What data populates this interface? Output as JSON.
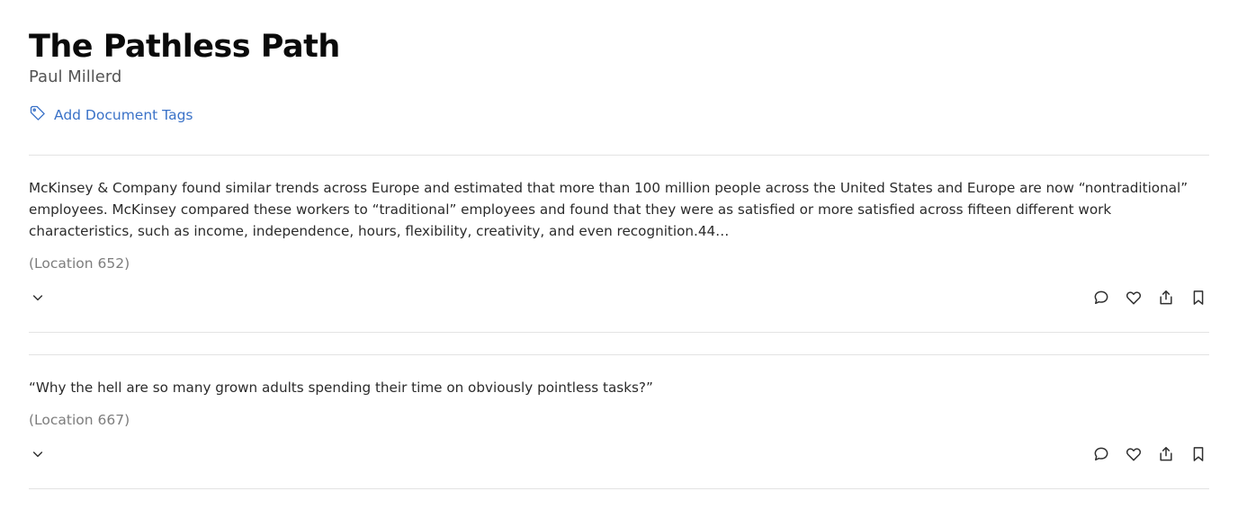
{
  "book": {
    "title": "The Pathless Path",
    "author": "Paul Millerd"
  },
  "tags": {
    "add_label": "Add Document Tags",
    "icon": "tag-icon"
  },
  "highlights": [
    {
      "text": "McKinsey & Company found similar trends across Europe and estimated that more than 100 million people across the United States and Europe are now “nontraditional” employees. McKinsey compared these workers to “traditional” employees and found that they were as satisfied or more satisfied across fifteen different work characteristics, such as income, independence, hours, flexibility, creativity, and even recognition.44…",
      "location": "(Location 652)"
    },
    {
      "text": "“Why the hell are so many grown adults spending their time on obviously pointless tasks?”",
      "location": "(Location 667)"
    }
  ],
  "icons": {
    "expand": "chevron-down-icon",
    "comment": "comment-icon",
    "favorite": "heart-icon",
    "share": "share-icon",
    "bookmark": "bookmark-icon"
  },
  "colors": {
    "link": "#3a72c8",
    "text": "#2b2b2b",
    "muted": "#7d7d7d",
    "divider": "#e3e3e3"
  }
}
